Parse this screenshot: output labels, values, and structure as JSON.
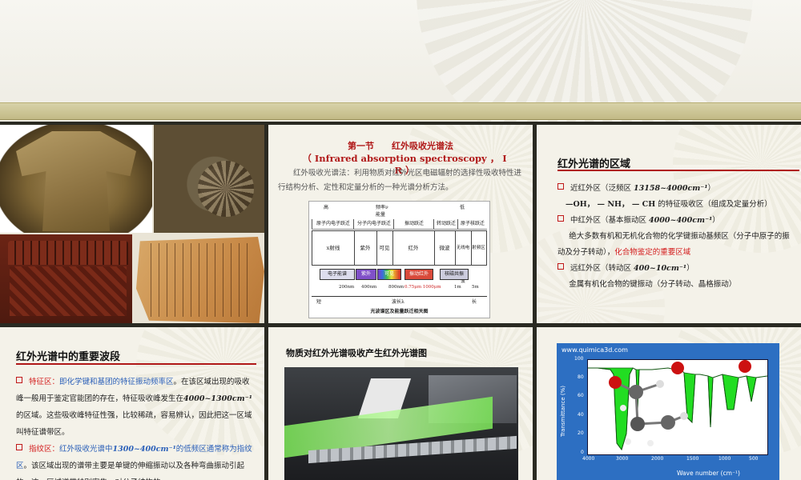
{
  "panel2": {
    "title": "第一节　　红外吸收光谱法",
    "subtitle": "（ Infrared absorption spectroscopy ，  I R ）",
    "paragraph": "红外吸收光谱法：利用物质对红外光区电磁辐射的选择性吸收特性进行结构分析、定性和定量分析的一种光谱分析方法。",
    "spectrum": {
      "top_labels": [
        "高",
        "频率ν",
        "低"
      ],
      "energy": "能量",
      "transitions": [
        "原子内电子跃迁",
        "分子内电子跃迁",
        "振动跃迁",
        "转动跃迁",
        "原子核跃迁"
      ],
      "regions": [
        "x射线",
        "紫外",
        "可见",
        "红外",
        "微波",
        "无线电波",
        "射频区"
      ],
      "tags": [
        "电子能谱",
        "紫外",
        "可见",
        "振动红外",
        "核磁共振"
      ],
      "abbr": [
        "UV",
        "IR",
        "NMR"
      ],
      "scale": [
        "200nm",
        "400nm",
        "800nm",
        "0.75μm  1000μm",
        "1m",
        "5m"
      ],
      "axis": [
        "短",
        "波长λ",
        "长"
      ],
      "caption": "光波谱区及能量跃迁相关图"
    }
  },
  "panel3": {
    "title": "红外光谱的区域",
    "near_label": "近红外区（泛频区",
    "near_range": "13158~4000cm⁻¹",
    "near_close": "）",
    "near_detail_groups": "—OH，  — NH，  — CH",
    "near_detail_rest": "的特征吸收区（组成及定量分析）",
    "mid_label": "中红外区（基本振动区",
    "mid_range": "4000~400cm⁻¹",
    "mid_close": "）",
    "mid_detail": "绝大多数有机和无机化合物的化学键振动基频区（分子中原子的振动及分子转动），",
    "mid_detail_red": "化合物鉴定的重要区域",
    "far_label": "远红外区（转动区",
    "far_range": "400~10cm⁻¹",
    "far_close": "）",
    "far_detail": "金属有机化合物的键振动（分子转动、晶格振动）"
  },
  "panel4": {
    "title": "红外光谱中的重要波段",
    "f1_label": "特征区：",
    "f1_red": "即化学键和基团的特征振动频率区",
    "f1_text1": "。在该区域出现的吸收峰一般用于鉴定官能团的存在，特征吸收峰发生在",
    "f1_range": "4000~1300cm⁻¹",
    "f1_text2": "的区域。这些吸收峰特征性强，比较稀疏，容易辨认，因此把这一区域叫特征谱带区。",
    "f2_label": "指纹区：",
    "f2_blue1": "红外吸收光谱中",
    "f2_range": "1300~400cm⁻¹",
    "f2_blue2": "的低频区通常称为指纹区",
    "f2_text": "。该区域出现的谱带主要是单键的伸缩振动以及各种弯曲振动引起的。这一区域谱带特别密集，对分子结构的"
  },
  "panel5": {
    "title": "物质对红外光谱吸收产生红外光谱图"
  },
  "panel6": {
    "site": "www.quimica3d.com",
    "ylabel": "Transmittance (%)",
    "xlabel": "Wave number (cm⁻¹)",
    "yticks": [
      "100",
      "80",
      "60",
      "40",
      "20",
      "0"
    ],
    "xticks": [
      "4000",
      "3000",
      "2000",
      "1500",
      "1000",
      "500"
    ],
    "colors": {
      "fill": "#22dd22",
      "background": "#2d6fc2"
    }
  }
}
